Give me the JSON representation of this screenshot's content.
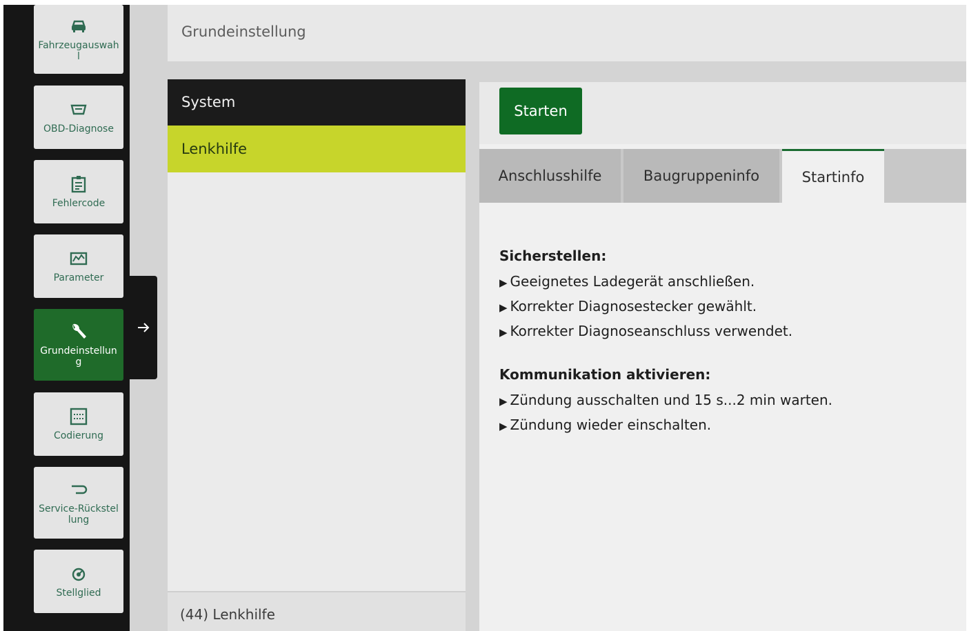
{
  "sidebar": {
    "items": [
      {
        "label": "Fahrzeugauswahl",
        "icon": "car-icon"
      },
      {
        "label": "OBD-Diagnose",
        "icon": "obd-plug-icon"
      },
      {
        "label": "Fehlercode",
        "icon": "fault-list-icon"
      },
      {
        "label": "Parameter",
        "icon": "parameter-gauge-icon"
      },
      {
        "label": "Grundeinstellung",
        "icon": "wrench-icon",
        "active": true
      },
      {
        "label": "Codierung",
        "icon": "binary-code-icon"
      },
      {
        "label": "Service-Rückstellung",
        "icon": "service-reset-icon"
      },
      {
        "label": "Stellglied",
        "icon": "actuator-icon"
      }
    ],
    "flyout_icon": "arrow-right-icon"
  },
  "header": {
    "title": "Grundeinstellung"
  },
  "system_list": {
    "header": "System",
    "items": [
      {
        "label": "Lenkhilfe",
        "selected": true
      }
    ],
    "footer": "(44) Lenkhilfe"
  },
  "toolbar": {
    "start_label": "Starten"
  },
  "tabs": [
    {
      "label": "Anschlusshilfe"
    },
    {
      "label": "Baugruppeninfo"
    },
    {
      "label": "Startinfo",
      "active": true
    }
  ],
  "startinfo": {
    "sections": [
      {
        "heading": "Sicherstellen:",
        "bullets": [
          "Geeignetes Ladegerät anschließen.",
          "Korrekter Diagnosestecker gewählt.",
          "Korrekter Diagnoseanschluss verwendet."
        ]
      },
      {
        "heading": "Kommunikation aktivieren:",
        "bullets": [
          "Zündung ausschalten und 15 s...2 min warten.",
          "Zündung wieder einschalten."
        ]
      }
    ]
  },
  "colors": {
    "accent_green": "#1f6b2a",
    "start_button": "#0f6b24",
    "selection_yellow": "#c7d52b",
    "sidebar_bg": "#161616"
  }
}
